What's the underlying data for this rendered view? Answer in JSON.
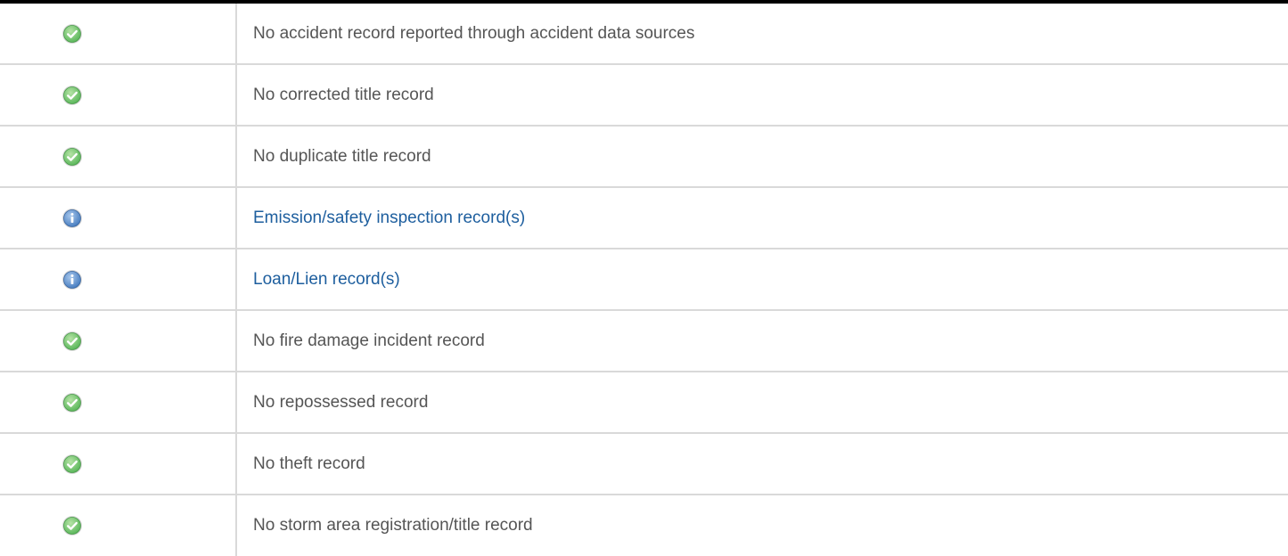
{
  "records": [
    {
      "status": "ok",
      "icon": "check-circle-icon",
      "text": "No accident record reported through accident data sources",
      "is_link": false
    },
    {
      "status": "ok",
      "icon": "check-circle-icon",
      "text": "No corrected title record",
      "is_link": false
    },
    {
      "status": "ok",
      "icon": "check-circle-icon",
      "text": "No duplicate title record",
      "is_link": false
    },
    {
      "status": "info",
      "icon": "info-circle-icon",
      "text": "Emission/safety inspection record(s)",
      "is_link": true
    },
    {
      "status": "info",
      "icon": "info-circle-icon",
      "text": "Loan/Lien record(s)",
      "is_link": true
    },
    {
      "status": "ok",
      "icon": "check-circle-icon",
      "text": "No fire damage incident record",
      "is_link": false
    },
    {
      "status": "ok",
      "icon": "check-circle-icon",
      "text": "No repossessed record",
      "is_link": false
    },
    {
      "status": "ok",
      "icon": "check-circle-icon",
      "text": "No theft record",
      "is_link": false
    },
    {
      "status": "ok",
      "icon": "check-circle-icon",
      "text": "No storm area registration/title record",
      "is_link": false
    }
  ],
  "colors": {
    "ok_icon": "#5cb85c",
    "info_icon": "#4a7fc1",
    "link_text": "#1d5e9e",
    "plain_text": "#555555",
    "row_divider": "#d9d9d9"
  }
}
